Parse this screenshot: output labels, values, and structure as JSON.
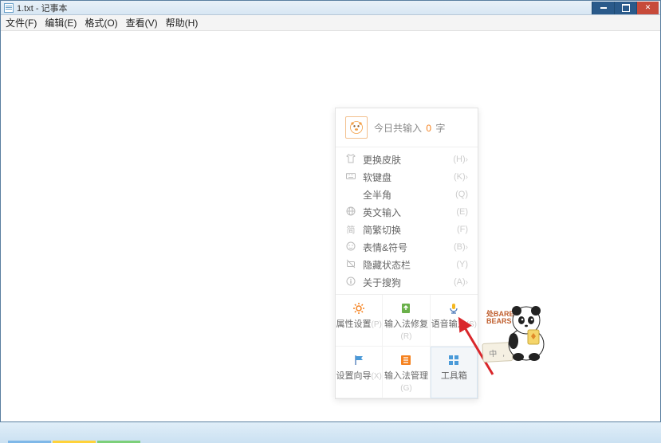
{
  "window": {
    "title": "1.txt - 记事本"
  },
  "menu": {
    "file": "文件(F)",
    "edit": "编辑(E)",
    "format": "格式(O)",
    "view": "查看(V)",
    "help": "帮助(H)"
  },
  "ime": {
    "header_prefix": "今日共输入 ",
    "header_count": "0",
    "header_suffix": " 字",
    "items": [
      {
        "icon": "shirt",
        "label": "更换皮肤",
        "key": "(H)",
        "arrow": true
      },
      {
        "icon": "keyboard",
        "label": "软键盘",
        "key": "(K)",
        "arrow": true
      },
      {
        "icon": "moon",
        "label": "全半角",
        "key": "(Q)",
        "arrow": false
      },
      {
        "icon": "globe",
        "label": "英文输入",
        "key": "(E)",
        "arrow": false
      },
      {
        "icon": "simp",
        "label": "简繁切换",
        "key": "(F)",
        "arrow": false
      },
      {
        "icon": "smile",
        "label": "表情&符号",
        "key": "(B)",
        "arrow": true
      },
      {
        "icon": "hide",
        "label": "隐藏状态栏",
        "key": "(Y)",
        "arrow": false
      },
      {
        "icon": "info",
        "label": "关于搜狗",
        "key": "(A)",
        "arrow": true
      }
    ],
    "grid": [
      {
        "icon": "gear",
        "label": "属性设置",
        "key": "(P)",
        "hl": false
      },
      {
        "icon": "repair",
        "label": "输入法修复",
        "key": "(R)",
        "hl": false
      },
      {
        "icon": "mic",
        "label": "语音输入",
        "key": "(S)",
        "hl": false
      },
      {
        "icon": "flag",
        "label": "设置向导",
        "key": "(X)",
        "hl": false
      },
      {
        "icon": "list",
        "label": "输入法管理",
        "key": "(G)",
        "hl": false
      },
      {
        "icon": "grid",
        "label": "工具箱",
        "key": "",
        "hl": true
      }
    ]
  },
  "mascot": {
    "logo_line1": "处BARE",
    "logo_line2": "BEARS",
    "zh_badge": "中 ,"
  },
  "colors": {
    "accent": "#f58220",
    "highlight_bg": "#f3f6f9",
    "arrow": "#d9262a"
  }
}
